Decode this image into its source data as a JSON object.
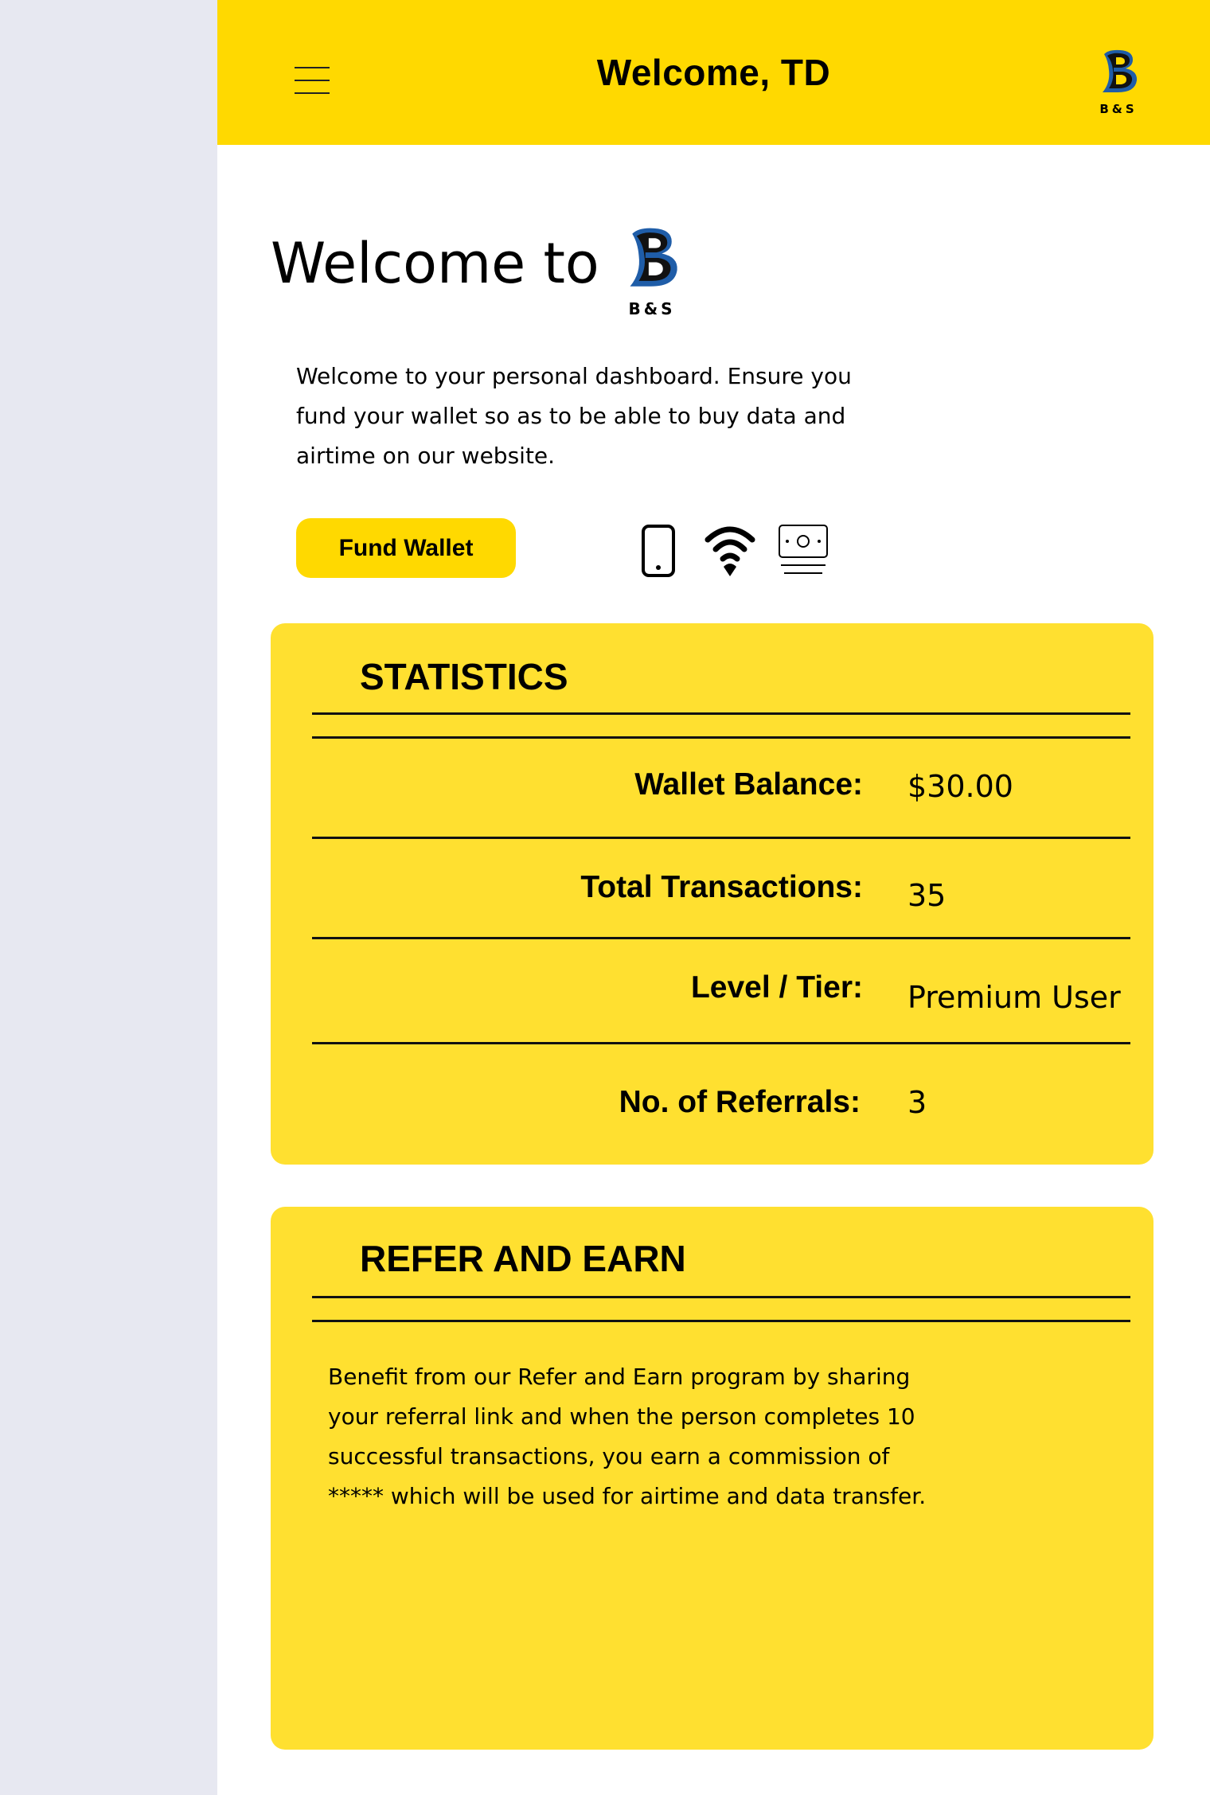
{
  "topbar": {
    "title": "Welcome, TD",
    "logo_text": "B&S"
  },
  "hero": {
    "heading": "Welcome to",
    "logo_text": "B&S",
    "description": "Welcome to your personal dashboard. Ensure you fund your wallet so as to be able to buy data and airtime on our website.",
    "fund_button": "Fund Wallet"
  },
  "services": [
    "phone-icon",
    "wifi-icon",
    "cash-icon"
  ],
  "statistics": {
    "title": "STATISTICS",
    "rows": [
      {
        "label": "Wallet Balance:",
        "value": "$30.00"
      },
      {
        "label": "Total Transactions:",
        "value": "35"
      },
      {
        "label": "Level / Tier:",
        "value": "Premium User"
      },
      {
        "label": "No. of Referrals:",
        "value": "3"
      }
    ]
  },
  "refer": {
    "title": "REFER AND EARN",
    "text": "Benefit from our Refer and Earn program by sharing your referral link and when the person completes 10 successful transactions, you earn a commission of ***** which will be used for airtime and data transfer."
  },
  "colors": {
    "accent": "#FFD900",
    "card": "#FFE030",
    "sidebar": "#E7E8F1",
    "logo_blue": "#1F5DA8"
  }
}
